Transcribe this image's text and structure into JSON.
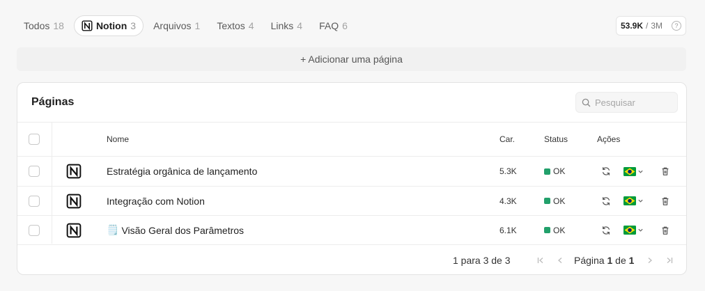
{
  "tabs": [
    {
      "label": "Todos",
      "count": "18"
    },
    {
      "label": "Notion",
      "count": "3"
    },
    {
      "label": "Arquivos",
      "count": "1"
    },
    {
      "label": "Textos",
      "count": "4"
    },
    {
      "label": "Links",
      "count": "4"
    },
    {
      "label": "FAQ",
      "count": "6"
    }
  ],
  "active_tab": "Notion",
  "quota": {
    "used": "53.9K",
    "separator": "/",
    "limit": "3M",
    "help": "?"
  },
  "add_page_label": "+ Adicionar uma página",
  "card": {
    "title": "Páginas",
    "search_placeholder": "Pesquisar"
  },
  "table": {
    "headers": {
      "name": "Nome",
      "chars": "Car.",
      "status": "Status",
      "actions": "Ações"
    },
    "rows": [
      {
        "name": "Estratégia orgânica de lançamento",
        "chars": "5.3K",
        "status": "OK",
        "emoji": ""
      },
      {
        "name": "Integração com Notion",
        "chars": "4.3K",
        "status": "OK",
        "emoji": ""
      },
      {
        "name": "Visão Geral dos Parâmetros",
        "chars": "6.1K",
        "status": "OK",
        "emoji": "🗒️"
      }
    ]
  },
  "pagination": {
    "range_text": "1 para 3 de 3",
    "page_label": "Página",
    "current": "1",
    "of_label": "de",
    "total": "1"
  },
  "colors": {
    "status_ok": "#22a06b",
    "flag_green": "#009b3a",
    "flag_yellow": "#fedf00",
    "flag_blue": "#002776"
  }
}
